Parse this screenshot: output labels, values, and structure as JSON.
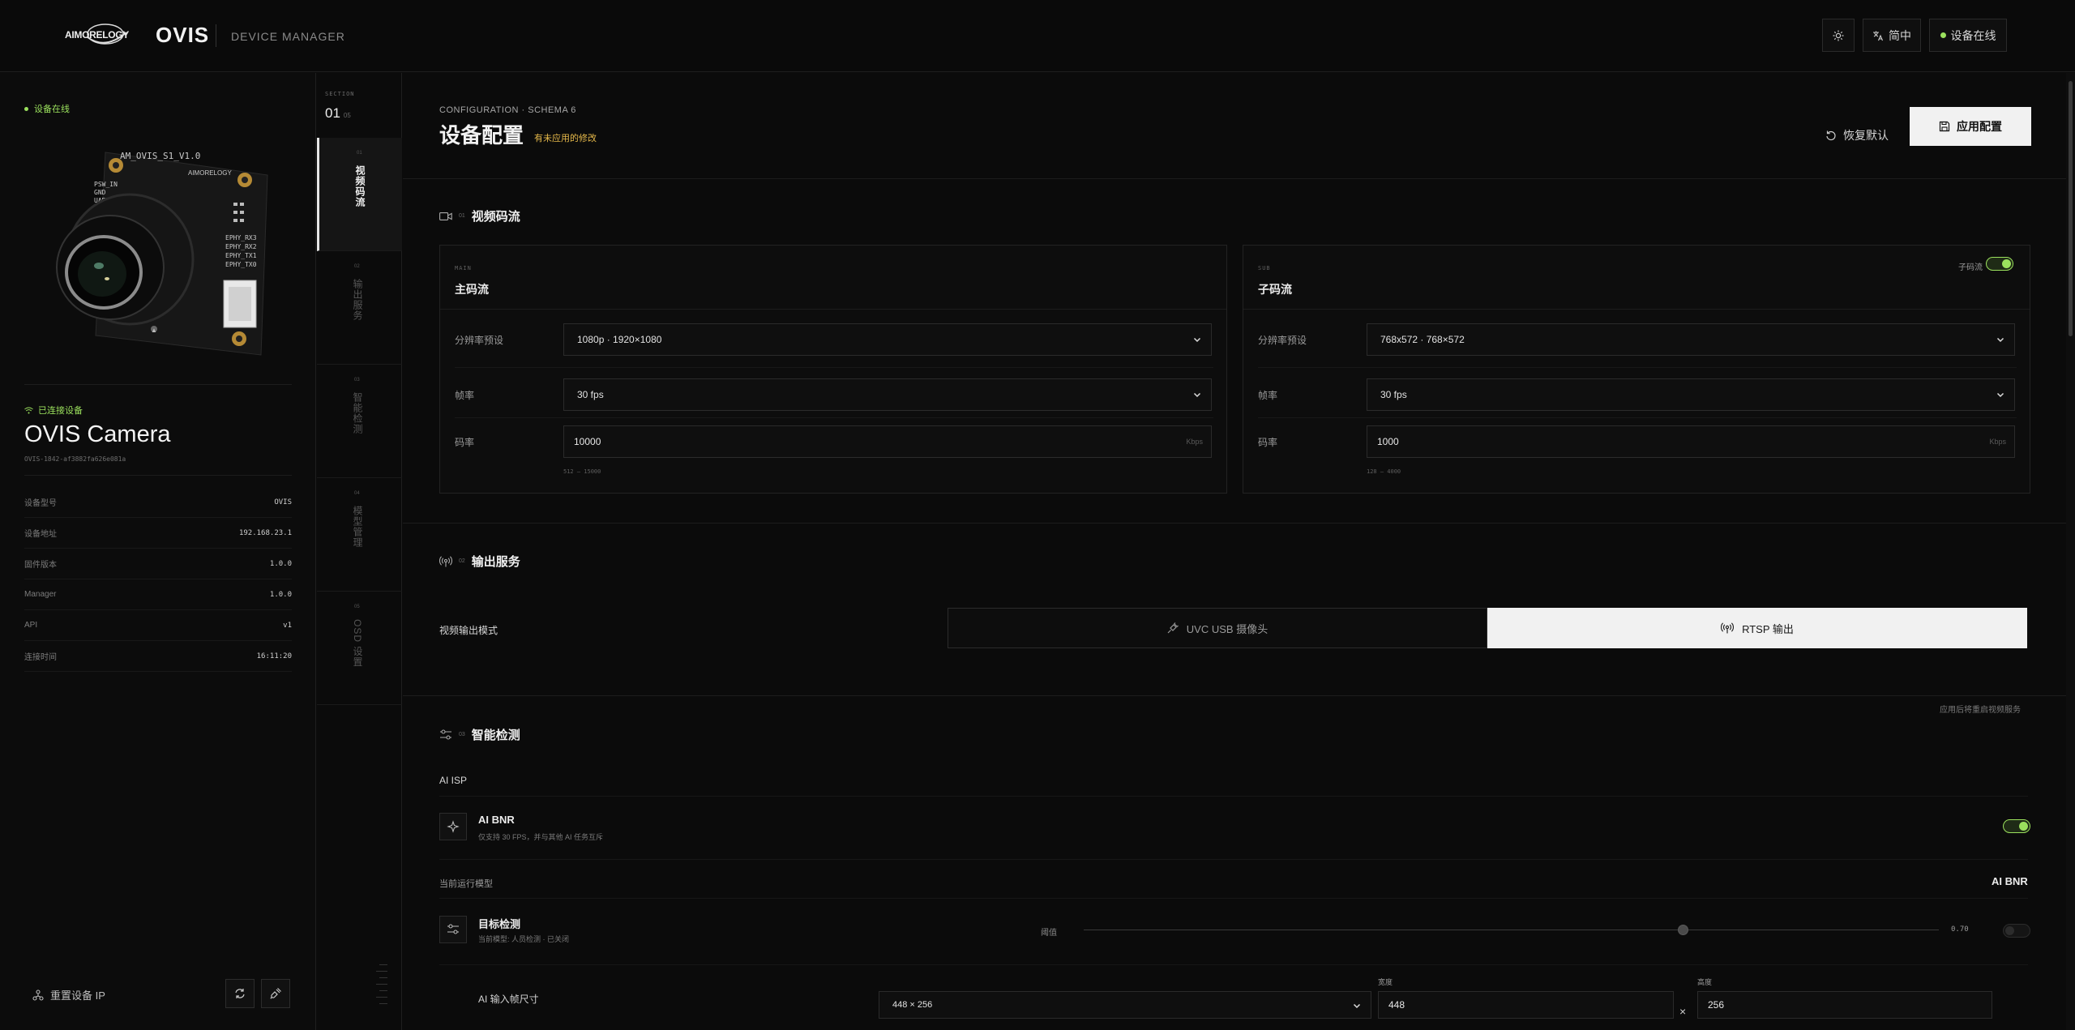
{
  "header": {
    "brand": "OVIS",
    "subtitle": "DEVICE MANAGER",
    "lang_label": "简中",
    "status_label": "设备在线"
  },
  "left_panel": {
    "online_label": "设备在线",
    "connected_label": "已连接设备",
    "device_name": "OVIS Camera",
    "device_id": "OVIS-1842-af3882fa626e081a",
    "info": [
      {
        "key": "设备型号",
        "value": "OVIS"
      },
      {
        "key": "设备地址",
        "value": "192.168.23.1"
      },
      {
        "key": "固件版本",
        "value": "1.0.0"
      },
      {
        "key": "Manager",
        "value": "1.0.0"
      },
      {
        "key": "API",
        "value": "v1"
      },
      {
        "key": "连接时间",
        "value": "16:11:20"
      }
    ],
    "reset_ip_label": "重置设备 IP"
  },
  "section_nav": {
    "label": "SECTION",
    "current": "01",
    "total": "05",
    "items": [
      {
        "num": "01",
        "label": "视频码流"
      },
      {
        "num": "02",
        "label": "输出服务"
      },
      {
        "num": "03",
        "label": "智能检测"
      },
      {
        "num": "04",
        "label": "模型管理"
      },
      {
        "num": "05",
        "label": "OSD 设置"
      }
    ]
  },
  "config": {
    "schema_label": "CONFIGURATION · SCHEMA 6",
    "title": "设备配置",
    "pending_label": "有未应用的修改",
    "restore_label": "恢复默认",
    "apply_label": "应用配置"
  },
  "video_stream": {
    "num": "01",
    "title": "视频码流",
    "main": {
      "tag": "MAIN",
      "title": "主码流",
      "resolution_label": "分辨率预设",
      "resolution_value": "1080p · 1920×1080",
      "fps_label": "帧率",
      "fps_value": "30 fps",
      "bitrate_label": "码率",
      "bitrate_value": "10000",
      "bitrate_unit": "Kbps",
      "bitrate_hint": "512 – 15000"
    },
    "sub": {
      "tag": "SUB",
      "title": "子码流",
      "toggle_label": "子码流",
      "enabled": true,
      "resolution_label": "分辨率预设",
      "resolution_value": "768x572 · 768×572",
      "fps_label": "帧率",
      "fps_value": "30 fps",
      "bitrate_label": "码率",
      "bitrate_value": "1000",
      "bitrate_unit": "Kbps",
      "bitrate_hint": "128 – 4000"
    }
  },
  "output_service": {
    "num": "02",
    "title": "输出服务",
    "mode_label": "视频输出模式",
    "options": [
      {
        "label": "UVC USB 摄像头",
        "selected": false
      },
      {
        "label": "RTSP 输出",
        "selected": true
      }
    ]
  },
  "smart_detect": {
    "num": "03",
    "title": "智能检测",
    "isp_label": "AI ISP",
    "isp_note": "应用后将重启视频服务",
    "bnr_title": "AI BNR",
    "bnr_desc": "仅支持 30 FPS，并与其他 AI 任务互斥",
    "bnr_enabled": true,
    "model_label": "当前运行模型",
    "model_value": "AI BNR",
    "detect_title": "目标检测",
    "detect_desc": "当前模型: 人员检测 · 已关闭",
    "threshold_label": "阈值",
    "threshold_value": "0.70",
    "threshold_fraction": 0.7,
    "detect_enabled": false,
    "input_size_label": "AI 输入帧尺寸",
    "input_size_value": "448 × 256",
    "width_label": "宽度",
    "width_value": "448",
    "height_label": "高度",
    "height_value": "256",
    "times": "×"
  }
}
